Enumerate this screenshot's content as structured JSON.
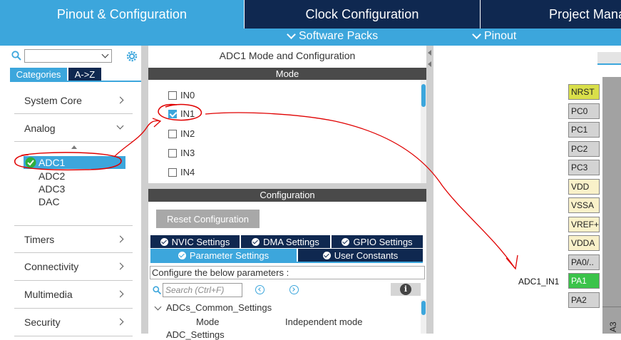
{
  "tabs": {
    "pinout": "Pinout & Configuration",
    "clock": "Clock Configuration",
    "project": "Project Manager"
  },
  "subbar": {
    "software_packs": "Software Packs",
    "pinout": "Pinout"
  },
  "left": {
    "categories_tab": "Categories",
    "az_tab": "A->Z",
    "items": {
      "system_core": "System Core",
      "analog": "Analog",
      "timers": "Timers",
      "connectivity": "Connectivity",
      "multimedia": "Multimedia",
      "security": "Security"
    },
    "analog_children": [
      "ADC1",
      "ADC2",
      "ADC3",
      "DAC"
    ]
  },
  "mid": {
    "title": "ADC1 Mode and Configuration",
    "mode_header": "Mode",
    "mode_channels": [
      {
        "label": "IN0",
        "checked": false
      },
      {
        "label": "IN1",
        "checked": true
      },
      {
        "label": "IN2",
        "checked": false
      },
      {
        "label": "IN3",
        "checked": false
      },
      {
        "label": "IN4",
        "checked": false
      }
    ],
    "config_header": "Configuration",
    "reset_button": "Reset Configuration",
    "config_tabs": {
      "nvic": "NVIC Settings",
      "dma": "DMA Settings",
      "gpio": "GPIO Settings",
      "parameter": "Parameter Settings",
      "user_constants": "User Constants"
    },
    "configure_text": "Configure the below parameters :",
    "search_placeholder": "Search (Ctrl+F)",
    "info_glyph": "i",
    "tree": {
      "group": "ADCs_Common_Settings",
      "mode_label": "Mode",
      "mode_value": "Independent mode",
      "next_group": "ADC_Settings"
    }
  },
  "right": {
    "pins": [
      "NRST",
      "PC0",
      "PC1",
      "PC2",
      "PC3",
      "VDD",
      "VSSA",
      "VREF+",
      "VDDA",
      "PA0/..",
      "PA1",
      "PA2"
    ],
    "signal_label": "ADC1_IN1",
    "chip_bottom_label": "A3"
  },
  "colors": {
    "accent": "#3ca6dc",
    "dark": "#0f2850",
    "active_pin": "#3bc34a",
    "annotation": "#e00000"
  }
}
